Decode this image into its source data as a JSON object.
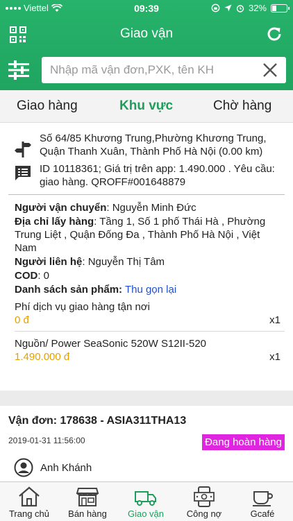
{
  "status_bar": {
    "carrier": "Viettel",
    "time": "09:39",
    "battery": "32%",
    "battery_level": 0.32
  },
  "header": {
    "title": "Giao vận"
  },
  "search": {
    "placeholder": "Nhập mã vận đơn,PXK, tên KH",
    "value": ""
  },
  "tabs": [
    {
      "label": "Giao hàng",
      "active": false
    },
    {
      "label": "Khu vực",
      "active": true
    },
    {
      "label": "Chờ hàng",
      "active": false
    }
  ],
  "card": {
    "address": "Số 64/85 Khương Trung,Phường Khương Trung, Quận Thanh Xuân, Thành Phố Hà Nội (0.00 km)",
    "note": "ID 10118361; Giá trị trên app: 1.490.000 . Yêu cầu: giao hàng. QROFF#001648879",
    "carrier_label": "Người vận chuyển",
    "carrier_value": ": Nguyễn Minh Đức",
    "pickup_label": "Địa chỉ lấy hàng",
    "pickup_value": ": Tầng 1, Số 1 phố Thái Hà , Phường Trung Liệt , Quận Đống Đa , Thành Phố Hà Nội , Việt Nam",
    "contact_label": "Người liên hệ",
    "contact_value": ": Nguyễn Thị Tâm",
    "cod_label": "COD",
    "cod_value": ": 0",
    "products_label": "Danh sách sản phẩm:",
    "collapse": "Thu gọn lại",
    "products": [
      {
        "name": "Phí dịch vụ giao hàng tận nơi",
        "price": "0 đ",
        "qty": "x1"
      },
      {
        "name": "Nguồn/ Power SeaSonic 520W S12II-520",
        "price": "1.490.000 đ",
        "qty": "x1"
      }
    ]
  },
  "order": {
    "waybill": "Vận đơn: 178638 -  ASIA311THA13",
    "date": "2019-01-31 11:56:00",
    "status": "Đang hoàn hàng",
    "user": "Anh Khánh"
  },
  "bottom_nav": [
    {
      "label": "Trang chủ",
      "icon": "home-icon",
      "active": false
    },
    {
      "label": "Bán hàng",
      "icon": "store-icon",
      "active": false
    },
    {
      "label": "Giao vận",
      "icon": "truck-icon",
      "active": true
    },
    {
      "label": "Công nợ",
      "icon": "debt-phone-icon",
      "active": false
    },
    {
      "label": "Gcafé",
      "icon": "coffee-cup-icon",
      "active": false
    }
  ],
  "colors": {
    "primary_green": "#1fa560",
    "active_tab": "#1f9e5b",
    "price": "#e5a000",
    "link": "#1f4fd0",
    "badge": "#e025e0"
  }
}
